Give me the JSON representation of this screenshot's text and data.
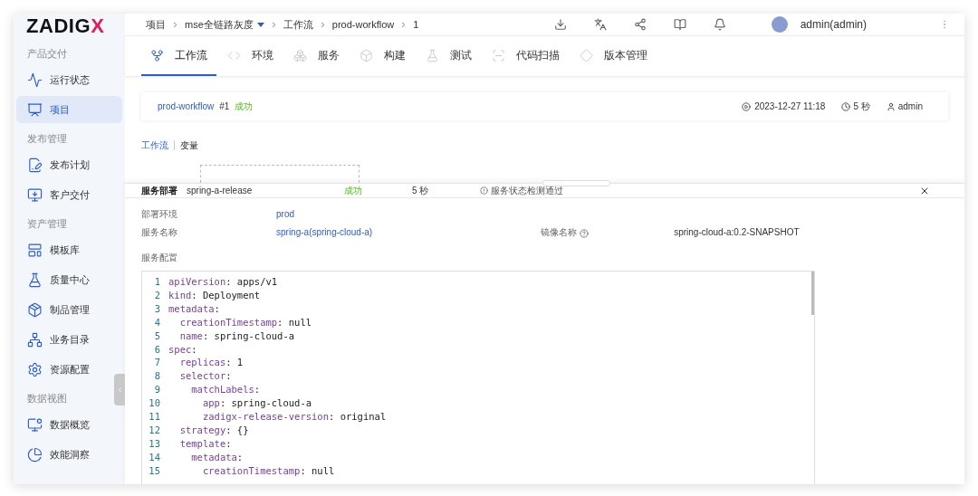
{
  "logo": {
    "text": "ZADIG",
    "accent": "X"
  },
  "sidebar": {
    "groups": [
      {
        "title": "产品交付",
        "items": [
          {
            "label": "运行状态",
            "selected": false
          },
          {
            "label": "项目",
            "selected": true
          }
        ]
      },
      {
        "title": "发布管理",
        "items": [
          {
            "label": "发布计划",
            "selected": false
          },
          {
            "label": "客户交付",
            "selected": false
          }
        ]
      },
      {
        "title": "资产管理",
        "items": [
          {
            "label": "模板库",
            "selected": false
          },
          {
            "label": "质量中心",
            "selected": false
          },
          {
            "label": "制品管理",
            "selected": false
          },
          {
            "label": "业务目录",
            "selected": false
          },
          {
            "label": "资源配置",
            "selected": false
          }
        ]
      },
      {
        "title": "数据视图",
        "items": [
          {
            "label": "数据概览",
            "selected": false
          },
          {
            "label": "效能洞察",
            "selected": false
          }
        ]
      }
    ]
  },
  "breadcrumb": [
    {
      "label": "项目",
      "dropdown": false
    },
    {
      "label": "mse全链路灰度",
      "dropdown": true
    },
    {
      "label": "工作流",
      "dropdown": false
    },
    {
      "label": "prod-workflow",
      "dropdown": false
    },
    {
      "label": "1",
      "dropdown": false
    }
  ],
  "user": {
    "name": "admin(admin)"
  },
  "tabs": [
    {
      "label": "工作流",
      "selected": true
    },
    {
      "label": "环境",
      "selected": false
    },
    {
      "label": "服务",
      "selected": false
    },
    {
      "label": "构建",
      "selected": false
    },
    {
      "label": "测试",
      "selected": false
    },
    {
      "label": "代码扫描",
      "selected": false
    },
    {
      "label": "版本管理",
      "selected": false
    }
  ],
  "run": {
    "workflow": "prod-workflow",
    "number": "#1",
    "status": "成功",
    "started": "2023-12-27 11:18",
    "duration": "5 秒",
    "creator": "admin"
  },
  "subtabs": [
    {
      "label": "工作流",
      "selected": true
    },
    {
      "label": "变量",
      "selected": false
    }
  ],
  "panel": {
    "title": "服务部署",
    "job": "spring-a-release",
    "status": "成功",
    "duration": "5 秒",
    "check": "服务状态检测通过",
    "fields": [
      {
        "label": "部署环境",
        "value": "prod"
      },
      {
        "label": "服务名称",
        "value": "spring-a(spring-cloud-a)"
      }
    ],
    "image": {
      "label": "镜像名称",
      "value": "spring-cloud-a:0.2-SNAPSHOT"
    },
    "config_label": "服务配置",
    "code": [
      {
        "n": "1",
        "key": "apiVersion",
        "rest": ": apps/v1"
      },
      {
        "n": "2",
        "key": "kind",
        "rest": ": Deployment"
      },
      {
        "n": "3",
        "key": "metadata",
        "rest": ":"
      },
      {
        "n": "4",
        "key": "  creationTimestamp",
        "rest": ": null"
      },
      {
        "n": "5",
        "key": "  name",
        "rest": ": spring-cloud-a"
      },
      {
        "n": "6",
        "key": "spec",
        "rest": ":"
      },
      {
        "n": "7",
        "key": "  replicas",
        "rest": ": 1"
      },
      {
        "n": "8",
        "key": "  selector",
        "rest": ":"
      },
      {
        "n": "9",
        "key": "    matchLabels",
        "rest": ":"
      },
      {
        "n": "10",
        "key": "      app",
        "rest": ": spring-cloud-a"
      },
      {
        "n": "11",
        "key": "      zadigx-release-version",
        "rest": ": original"
      },
      {
        "n": "12",
        "key": "  strategy",
        "rest": ": {}"
      },
      {
        "n": "13",
        "key": "  template",
        "rest": ":"
      },
      {
        "n": "14",
        "key": "    metadata",
        "rest": ":"
      },
      {
        "n": "15",
        "key": "      creationTimestamp",
        "rest": ": null"
      }
    ]
  }
}
